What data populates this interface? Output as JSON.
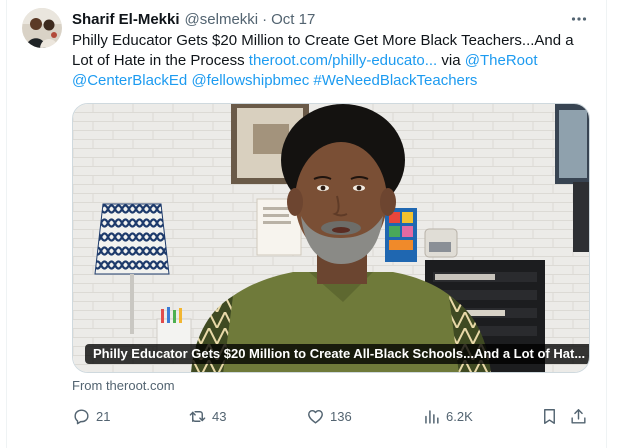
{
  "tweet": {
    "author": {
      "name": "Sharif El-Mekki",
      "handle": "@selmekki",
      "separator": "·",
      "date": "Oct 17"
    },
    "text": {
      "body": "Philly Educator Gets $20 Million to Create Get More Black Teachers...And a Lot of Hate in the Process",
      "link": "theroot.com/philly-educato...",
      "via": "via",
      "mention_root": "@TheRoot",
      "mention_center": "@CenterBlackEd",
      "mention_fellowship": "@fellowshipbmec",
      "hashtag": "#WeNeedBlackTeachers"
    },
    "media": {
      "caption": "Philly Educator Gets $20 Million to Create All-Black Schools...And a Lot of Hat..."
    },
    "source_label": "From theroot.com",
    "actions": {
      "replies": "21",
      "reposts": "43",
      "likes": "136",
      "views": "6.2K"
    }
  },
  "icons": [
    "avatar",
    "more-icon",
    "reply-icon",
    "repost-icon",
    "like-icon",
    "views-icon",
    "bookmark-icon",
    "share-icon"
  ],
  "colors": {
    "text": "#0f1419",
    "secondary": "#536471",
    "link": "#1d9bf0",
    "border": "#cfd9de"
  }
}
